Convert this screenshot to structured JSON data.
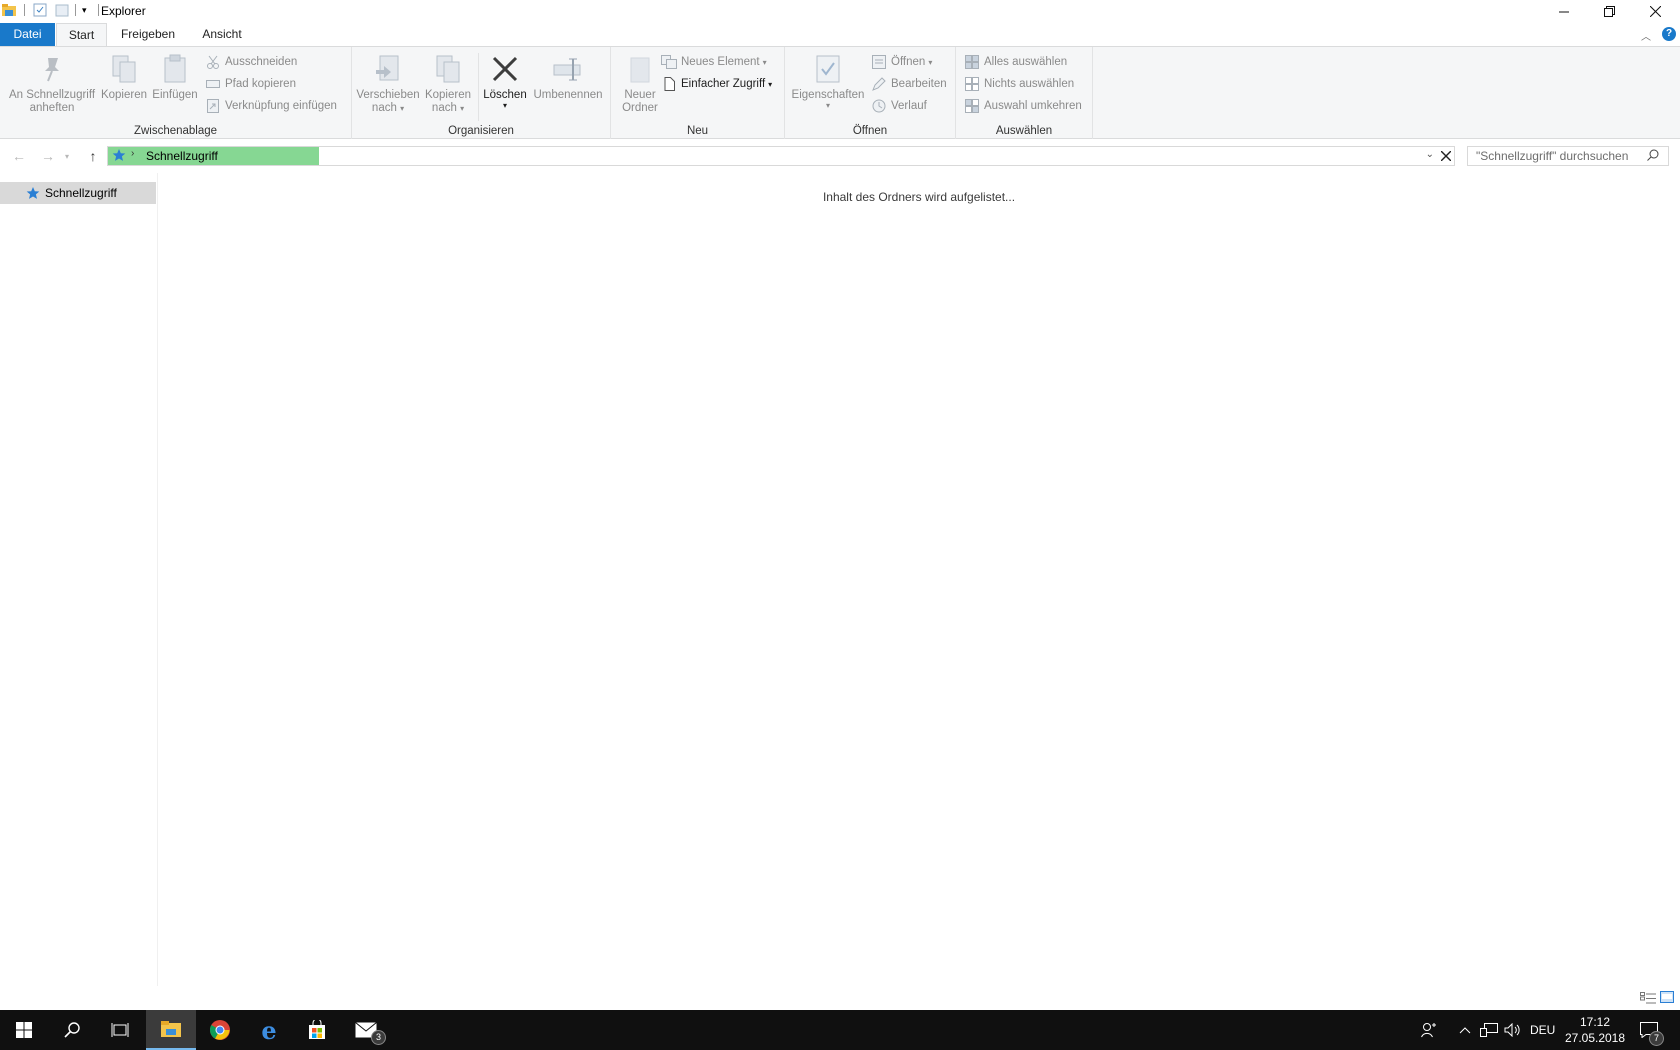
{
  "window": {
    "title": "Explorer"
  },
  "tabs": {
    "file": "Datei",
    "start": "Start",
    "share": "Freigeben",
    "view": "Ansicht"
  },
  "ribbon": {
    "clipboard": {
      "label": "Zwischenablage",
      "pin_line1": "An Schnellzugriff",
      "pin_line2": "anheften",
      "copy": "Kopieren",
      "paste": "Einfügen",
      "cut": "Ausschneiden",
      "copy_path": "Pfad kopieren",
      "paste_shortcut": "Verknüpfung einfügen"
    },
    "organize": {
      "label": "Organisieren",
      "move_line1": "Verschieben",
      "move_line2": "nach",
      "copyto_line1": "Kopieren",
      "copyto_line2": "nach",
      "delete": "Löschen",
      "rename": "Umbenennen"
    },
    "new": {
      "label": "Neu",
      "folder_line1": "Neuer",
      "folder_line2": "Ordner",
      "new_item": "Neues Element",
      "easy_access": "Einfacher Zugriff"
    },
    "open": {
      "label": "Öffnen",
      "properties": "Eigenschaften",
      "open": "Öffnen",
      "edit": "Bearbeiten",
      "history": "Verlauf"
    },
    "select": {
      "label": "Auswählen",
      "select_all": "Alles auswählen",
      "select_none": "Nichts auswählen",
      "invert": "Auswahl umkehren"
    }
  },
  "address": {
    "crumb": "Schnellzugriff",
    "search_placeholder": "\"Schnellzugriff\" durchsuchen"
  },
  "navpane": {
    "item": "Schnellzugriff"
  },
  "content": {
    "status": "Inhalt des Ordners wird aufgelistet..."
  },
  "taskbar": {
    "mail_badge": "3",
    "language": "DEU",
    "time": "17:12",
    "date": "27.05.2018",
    "notification_count": "7"
  },
  "colors": {
    "accent": "#1979ca",
    "address_highlight": "#86d793",
    "taskbar": "#101010"
  }
}
